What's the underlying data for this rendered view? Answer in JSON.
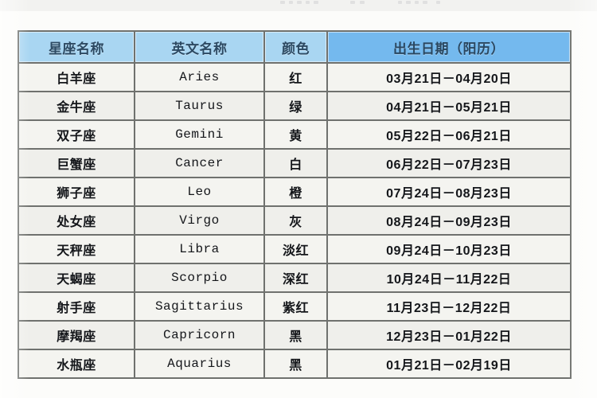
{
  "page": {
    "top_artifact_note": ""
  },
  "table": {
    "headers": [
      "星座名称",
      "英文名称",
      "颜色",
      "出生日期（阳历）"
    ],
    "rows": [
      {
        "name": "白羊座",
        "english": "Aries",
        "color": "红",
        "date": "03月21日－04月20日"
      },
      {
        "name": "金牛座",
        "english": "Taurus",
        "color": "绿",
        "date": "04月21日－05月21日"
      },
      {
        "name": "双子座",
        "english": "Gemini",
        "color": "黄",
        "date": "05月22日－06月21日"
      },
      {
        "name": "巨蟹座",
        "english": "Cancer",
        "color": "白",
        "date": "06月22日－07月23日"
      },
      {
        "name": "狮子座",
        "english": "Leo",
        "color": "橙",
        "date": "07月24日－08月23日"
      },
      {
        "name": "处女座",
        "english": "Virgo",
        "color": "灰",
        "date": "08月24日－09月23日"
      },
      {
        "name": "天秤座",
        "english": "Libra",
        "color": "淡红",
        "date": "09月24日－10月23日"
      },
      {
        "name": "天蝎座",
        "english": "Scorpio",
        "color": "深红",
        "date": "10月24日－11月22日"
      },
      {
        "name": "射手座",
        "english": "Sagittarius",
        "color": "紫红",
        "date": "11月23日－12月22日"
      },
      {
        "name": "摩羯座",
        "english": "Capricorn",
        "color": "黑",
        "date": "12月23日－01月22日"
      },
      {
        "name": "水瓶座",
        "english": "Aquarius",
        "color": "黑",
        "date": "01月21日－02月19日"
      }
    ]
  },
  "colors": {
    "header_fill": "#a9d6f2",
    "header_date_fill": "#74b9ee",
    "header_text": "#2d4a63",
    "grid_line": "#6f716e",
    "cell_fill": "#f2f2ee",
    "page_background": "#fcfcfa"
  }
}
